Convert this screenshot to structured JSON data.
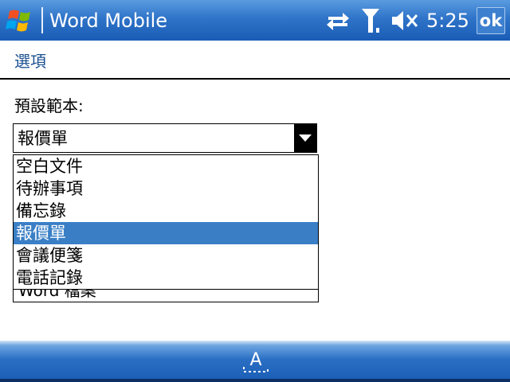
{
  "titlebar": {
    "start_icon": "windows-flag-icon",
    "title": "Word Mobile",
    "status_icons": [
      "sync-icon",
      "signal-icon",
      "volume-muted-icon"
    ],
    "clock": "5:25",
    "ok_label": "ok"
  },
  "page": {
    "title": "選項"
  },
  "form": {
    "template_label": "預設範本:",
    "template_selected": "報價單",
    "underlying_field_text": "Word 檔案"
  },
  "dropdown": {
    "options": [
      "空白文件",
      "待辦事項",
      "備忘錄",
      "報價單",
      "會議便箋",
      "電話記錄"
    ],
    "selected_index": 3
  },
  "softkeys": {
    "input_icon": "input-method-icon",
    "input_glyph": "A"
  },
  "colors": {
    "titlebar": "#2f74c9",
    "accent_text": "#1a4f91",
    "selection": "#3a7fc6"
  }
}
